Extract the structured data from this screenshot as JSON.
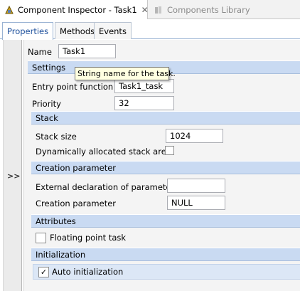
{
  "view_tabs": [
    {
      "label": "Component Inspector - Task1",
      "icon": "inspector-icon",
      "close": "✕"
    },
    {
      "label": "Components Library",
      "icon": "library-icon"
    }
  ],
  "sub_tabs": [
    "Properties",
    "Methods",
    "Events"
  ],
  "sidebar": {
    "toggle": ">>"
  },
  "name": {
    "label": "Name",
    "value": "Task1"
  },
  "settings": {
    "header": "Settings",
    "tooltip": "String name for the task.",
    "entry_point": {
      "label": "Entry point function",
      "value": "Task1_task"
    },
    "priority": {
      "label": "Priority",
      "value": "32"
    }
  },
  "stack": {
    "header": "Stack",
    "size": {
      "label": "Stack size",
      "value": "1024"
    },
    "dynamic": {
      "label": "Dynamically allocated stack area",
      "checked": false
    }
  },
  "creation": {
    "header": "Creation parameter",
    "external_decl": {
      "label": "External declaration of parameter",
      "value": ""
    },
    "param": {
      "label": "Creation parameter",
      "value": "NULL"
    }
  },
  "attributes": {
    "header": "Attributes",
    "floating": {
      "label": "Floating point task",
      "checked": false
    }
  },
  "initialization": {
    "header": "Initialization",
    "auto": {
      "label": "Auto initialization",
      "checked": true,
      "mark": "✓"
    }
  },
  "colors": {
    "section_bg": "#c9daf2",
    "active_tab_text": "#1c4f9c",
    "tooltip_bg": "#ffffe1"
  }
}
